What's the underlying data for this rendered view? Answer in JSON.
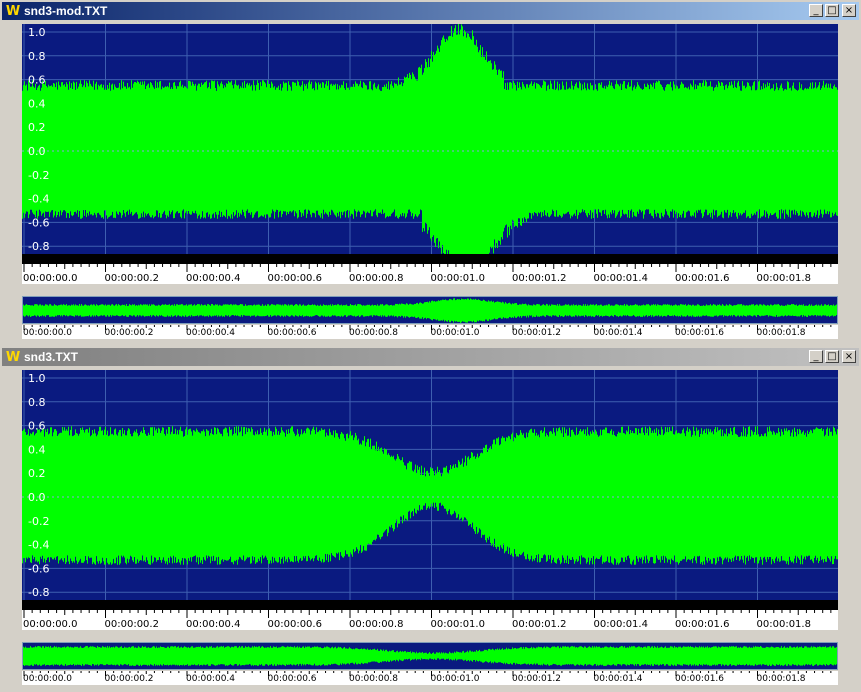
{
  "windows": [
    {
      "title": "snd3-mod.TXT",
      "active": true,
      "y_labels": [
        "1.0",
        "0.8",
        "0.6",
        "0.4",
        "0.2",
        "0.0",
        "-0.2",
        "-0.4",
        "-0.6",
        "-0.8"
      ],
      "time_labels": [
        "00:00:00.0",
        "00:00:00.2",
        "00:00:00.4",
        "00:00:00.6",
        "00:00:00.8",
        "00:00:01.0",
        "00:00:01.2",
        "00:00:01.4",
        "00:00:01.6",
        "00:00:01.8"
      ],
      "mini_labels": [
        "00:00:00.0",
        "00:00:00.2",
        "00:00:00.4",
        "00:00:00.6",
        "00:00:00.8",
        "00:00:01.0",
        "00:00:01.2",
        "00:00:01.4",
        "00:00:01.6",
        "00:00:01.8"
      ]
    },
    {
      "title": "snd3.TXT",
      "active": false,
      "y_labels": [
        "1.0",
        "0.8",
        "0.6",
        "0.4",
        "0.2",
        "0.0",
        "-0.2",
        "-0.4",
        "-0.6",
        "-0.8"
      ],
      "time_labels": [
        "00:00:00.0",
        "00:00:00.2",
        "00:00:00.4",
        "00:00:00.6",
        "00:00:00.8",
        "00:00:01.0",
        "00:00:01.2",
        "00:00:01.4",
        "00:00:01.6",
        "00:00:01.8"
      ],
      "mini_labels": [
        "00:00:00.0",
        "00:00:00.2",
        "00:00:00.4",
        "00:00:00.6",
        "00:00:00.8",
        "00:00:01.0",
        "00:00:01.2",
        "00:00:01.4",
        "00:00:01.6",
        "00:00:01.8"
      ]
    }
  ],
  "buttons": {
    "minimize": "_",
    "maximize": "□",
    "close": "×"
  },
  "icons": {
    "app": "W"
  },
  "colors": {
    "wave": "#00ff00",
    "background": "#0a1a80",
    "grid": "#4a6ab8"
  }
}
